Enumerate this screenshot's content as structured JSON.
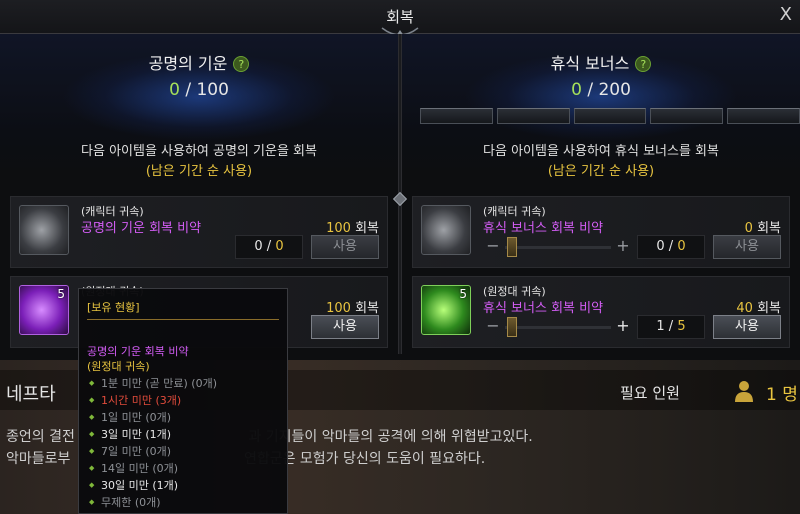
{
  "window": {
    "title": "회복",
    "close_glyph": "X"
  },
  "left_panel": {
    "title": "공명의 기운",
    "help": "?",
    "current": "0",
    "max": "/ 100",
    "desc": "다음 아이템을 사용하여 공명의 기운을 회복",
    "desc_sub": "(남은 기간 순 사용)",
    "items": [
      {
        "bind_type": "(캐릭터 귀속)",
        "name": "공명의 기운 회복 비약",
        "recover_value": "100",
        "recover_label": "회복",
        "qty_current": "0",
        "qty_sep": "/",
        "qty_total": "0",
        "use_label": "사용",
        "icon": "gray-orb-potion-icon"
      },
      {
        "bind_type": "(원정대 귀속)",
        "count_badge": "5",
        "recover_value": "100",
        "recover_label": "회복",
        "use_label": "사용",
        "icon": "purple-orb-potion-icon"
      }
    ]
  },
  "right_panel": {
    "title": "휴식 보너스",
    "help": "?",
    "current": "0",
    "max": "/ 200",
    "desc": "다음 아이템을 사용하여 휴식 보너스를 회복",
    "desc_sub": "(남은 기간 순 사용)",
    "items": [
      {
        "bind_type": "(캐릭터 귀속)",
        "name": "휴식 보너스 회복 비약",
        "recover_value": "0",
        "recover_label": "회복",
        "qty_current": "0",
        "qty_sep": "/",
        "qty_total": "0",
        "use_label": "사용",
        "minus": "−",
        "plus": "+",
        "icon": "gray-leaf-potion-icon"
      },
      {
        "bind_type": "(원정대 귀속)",
        "name": "휴식 보너스 회복 비약",
        "count_badge": "5",
        "recover_value": "40",
        "recover_label": "회복",
        "qty_current": "1",
        "qty_sep": "/",
        "qty_total": "5",
        "use_label": "사용",
        "minus": "−",
        "plus": "+",
        "icon": "green-leaf-potion-icon"
      }
    ]
  },
  "bottom": {
    "region": "네프타",
    "required_label": "필요 인원",
    "required_count": "1 명",
    "story_line1": "종언의 결전                                       과 기지들이 악마들의 공격에 의해 위협받고있다.",
    "story_line2": "악마들로부                                       연합군은 모험가 당신의 도움이 필요하다."
  },
  "tooltip": {
    "header": "[보유 현황]",
    "item_name": "공명의 기운 회복 비약",
    "item_sub": "(원정대 귀속)",
    "entries": [
      {
        "text": "1분 미만 (곧 만료) (0개)",
        "style": "dim"
      },
      {
        "text": "1시간 미만 (3개)",
        "style": "red"
      },
      {
        "text": "1일 미만 (0개)",
        "style": "dim"
      },
      {
        "text": "3일 미만 (1개)",
        "style": "white"
      },
      {
        "text": "7일 미만 (0개)",
        "style": "dim"
      },
      {
        "text": "14일 미만 (0개)",
        "style": "dim"
      },
      {
        "text": "30일 미만 (1개)",
        "style": "white"
      },
      {
        "text": "무제한 (0개)",
        "style": "dim"
      }
    ]
  },
  "colors": {
    "accent_green": "#a5e05a",
    "item_purple": "#d35df5",
    "gold": "#e8c440",
    "red": "#e14b3b"
  }
}
